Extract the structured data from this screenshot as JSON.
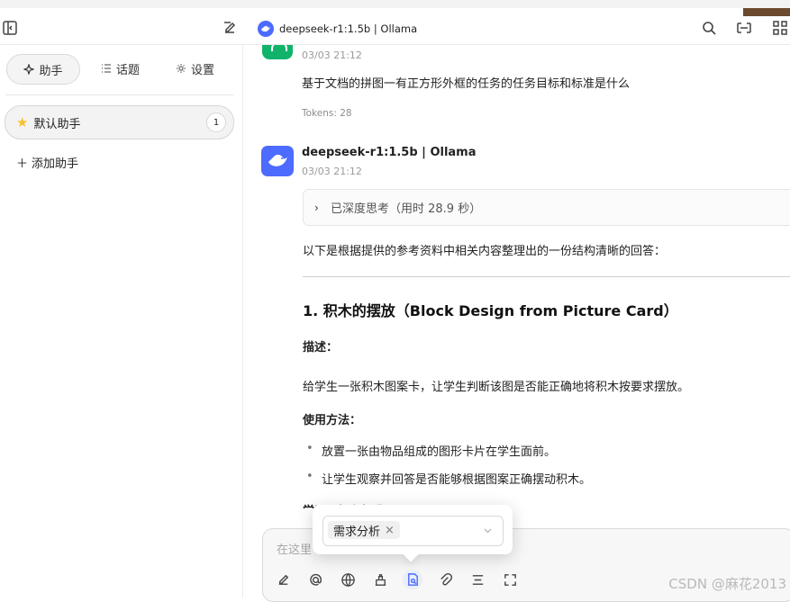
{
  "header": {
    "model_title": "deepseek-r1:1.5b | Ollama",
    "icons": [
      "sidebar-toggle-icon",
      "edit-icon",
      "search-icon",
      "layout-icon",
      "grid-icon"
    ]
  },
  "sidebar": {
    "tabs": [
      {
        "label": "助手",
        "icon": "sparkle-icon"
      },
      {
        "label": "话题",
        "icon": "list-icon"
      },
      {
        "label": "设置",
        "icon": "settings-icon"
      }
    ],
    "assistant": {
      "name": "默认助手",
      "count": "1",
      "icon": "star-icon"
    },
    "add_label": "添加助手"
  },
  "chat": {
    "user_time": "03/03 21:12",
    "user_message": "基于文档的拼图一有正方形外框的任务的任务目标和标准是什么",
    "tokens": "Tokens: 28",
    "bot_name": "deepseek-r1:1.5b | Ollama",
    "bot_time": "03/03 21:12",
    "thinking": "已深度思考（用时 28.9 秒）",
    "intro": "以下是根据提供的参考资料中相关内容整理出的一份结构清晰的回答：",
    "section_title": "1. 积木的摆放（Block Design from Picture Card）",
    "desc_label": "描述：",
    "description": "给学生一张积木图案卡，让学生判断该图是否能正确地将积木按要求摆放。",
    "method_label": "使用方法：",
    "methods": [
      "放置一张由物品组成的图形卡片在学生面前。",
      "让学生观察并回答是否能够根据图案正确摆动积木。"
    ],
    "cut_heading": "学习目标和标准"
  },
  "input": {
    "placeholder": "在这里",
    "chip": "需求分析",
    "tools": [
      "edit-icon",
      "mention-icon",
      "globe-icon",
      "tools-icon",
      "knowledge-icon",
      "attachment-icon",
      "layout-icon",
      "expand-icon"
    ]
  },
  "watermark": "CSDN @麻花2013"
}
